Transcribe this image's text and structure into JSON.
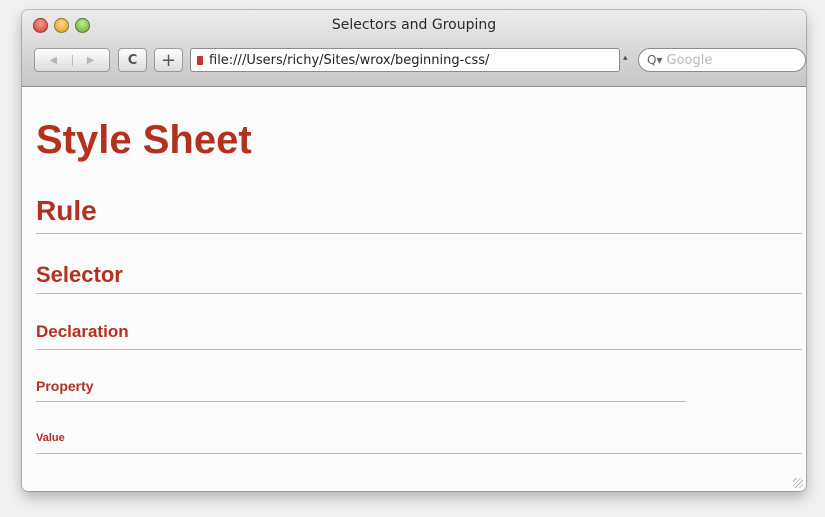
{
  "window": {
    "title": "Selectors and Grouping"
  },
  "toolbar": {
    "back_glyph": "◀",
    "forward_glyph": "▶",
    "reload_glyph": "C",
    "add_glyph": "+",
    "address_url": "file:///Users/richy/Sites/wrox/beginning-css/",
    "search_icon": "Q▾",
    "search_placeholder": "Google"
  },
  "page": {
    "h1": "Style Sheet",
    "h2": "Rule",
    "h3": "Selector",
    "h4": "Declaration",
    "h5": "Property",
    "h6": "Value"
  },
  "colors": {
    "heading": "#b3321f"
  }
}
